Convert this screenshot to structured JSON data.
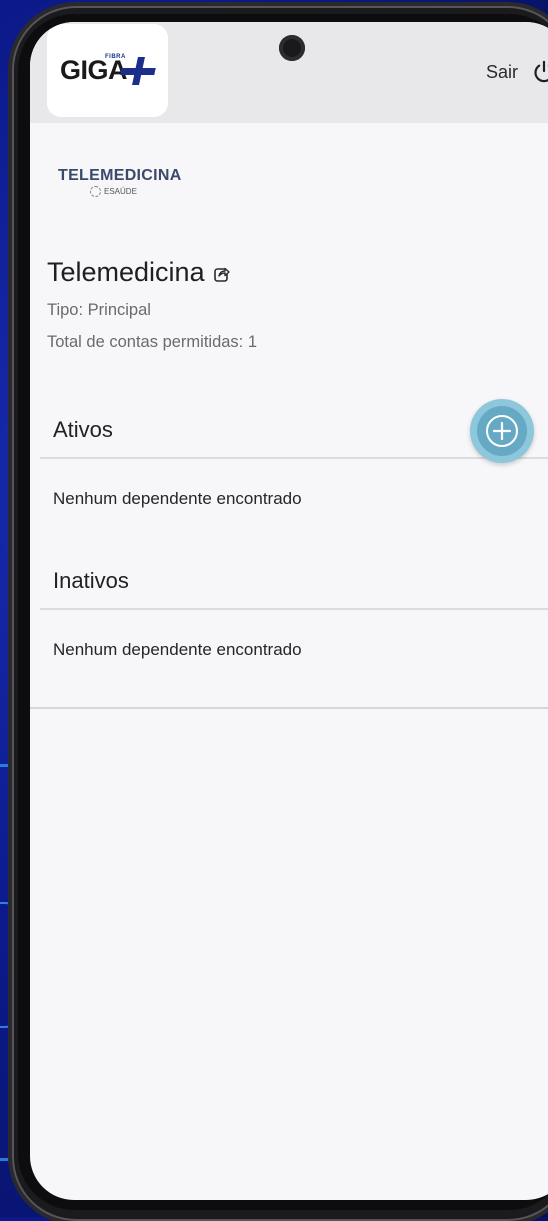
{
  "header": {
    "brand_name": "GIGA",
    "brand_sub": "FIBRA",
    "logout_label": "Sair",
    "logout_icon": "power-icon"
  },
  "plan_logo": {
    "title": "TELEMEDICINA",
    "subtitle": "ESAÚDE"
  },
  "plan": {
    "name": "Telemedicina",
    "share_icon": "share-icon",
    "tipo": "Tipo: Principal",
    "total": "Total de contas permitidas: 1"
  },
  "sections": {
    "ativos": {
      "title": "Ativos",
      "empty_message": "Nenhum dependente encontrado"
    },
    "inativos": {
      "title": "Inativos",
      "empty_message": "Nenhum dependente encontrado"
    }
  },
  "add_button": {
    "icon": "plus-circle-icon"
  },
  "colors": {
    "background": "#0c1a8c",
    "screen": "#f7f6f8",
    "topbar": "#e8e8ea",
    "fab_outer": "#8cc7db",
    "fab_inner": "#66a9c4",
    "brand_blue": "#1b2f8a"
  }
}
